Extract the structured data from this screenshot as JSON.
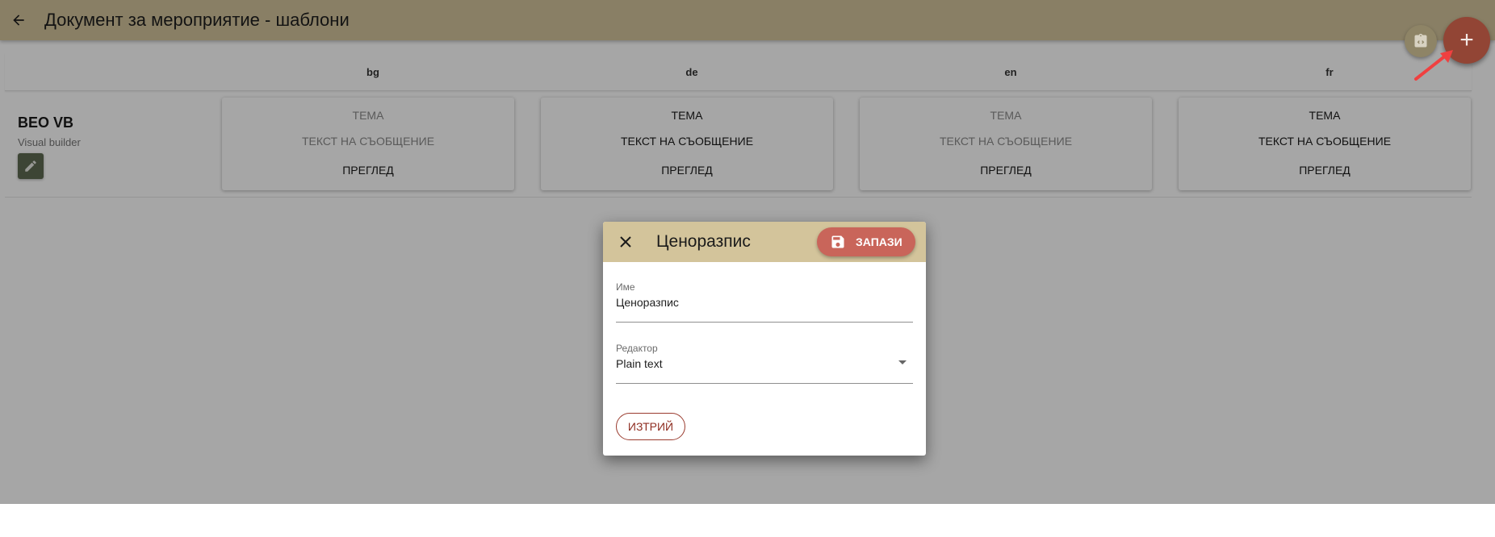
{
  "appbar": {
    "title": "Документ за мероприятие - шаблони"
  },
  "languages": [
    "bg",
    "de",
    "en",
    "fr"
  ],
  "row": {
    "name": "BEO VB",
    "subtitle": "Visual builder",
    "cards": [
      {
        "lang": "bg",
        "subject": "ТЕМА",
        "body": "ТЕКСТ НА СЪОБЩЕНИЕ",
        "preview": "ПРЕГЛЕД",
        "subject_active": false,
        "body_active": false
      },
      {
        "lang": "de",
        "subject": "ТЕМА",
        "body": "ТЕКСТ НА СЪОБЩЕНИЕ",
        "preview": "ПРЕГЛЕД",
        "subject_active": true,
        "body_active": true
      },
      {
        "lang": "en",
        "subject": "ТЕМА",
        "body": "ТЕКСТ НА СЪОБЩЕНИЕ",
        "preview": "ПРЕГЛЕД",
        "subject_active": false,
        "body_active": false
      },
      {
        "lang": "fr",
        "subject": "ТЕМА",
        "body": "ТЕКСТ НА СЪОБЩЕНИЕ",
        "preview": "ПРЕГЛЕД",
        "subject_active": true,
        "body_active": true
      }
    ]
  },
  "dialog": {
    "title": "Ценоразпис",
    "save_label": "ЗАПАЗИ",
    "name_field": {
      "label": "Име",
      "value": "Ценоразпис"
    },
    "editor_field": {
      "label": "Редактор",
      "value": "Plain text"
    },
    "delete_label": "ИЗТРИЙ"
  },
  "icons": {
    "back": "arrow-left-icon",
    "edit": "pencil-icon",
    "code": "code-clipboard-icon",
    "add": "plus-icon",
    "close": "close-icon",
    "save": "floppy-disk-icon"
  },
  "colors": {
    "appbar": "#d3c49b",
    "fab_add": "#924535",
    "save_button": "#c9655a",
    "delete_outline": "#9a3b2e",
    "edit_button": "#5e6a52",
    "annotation_arrow": "#f04040"
  }
}
